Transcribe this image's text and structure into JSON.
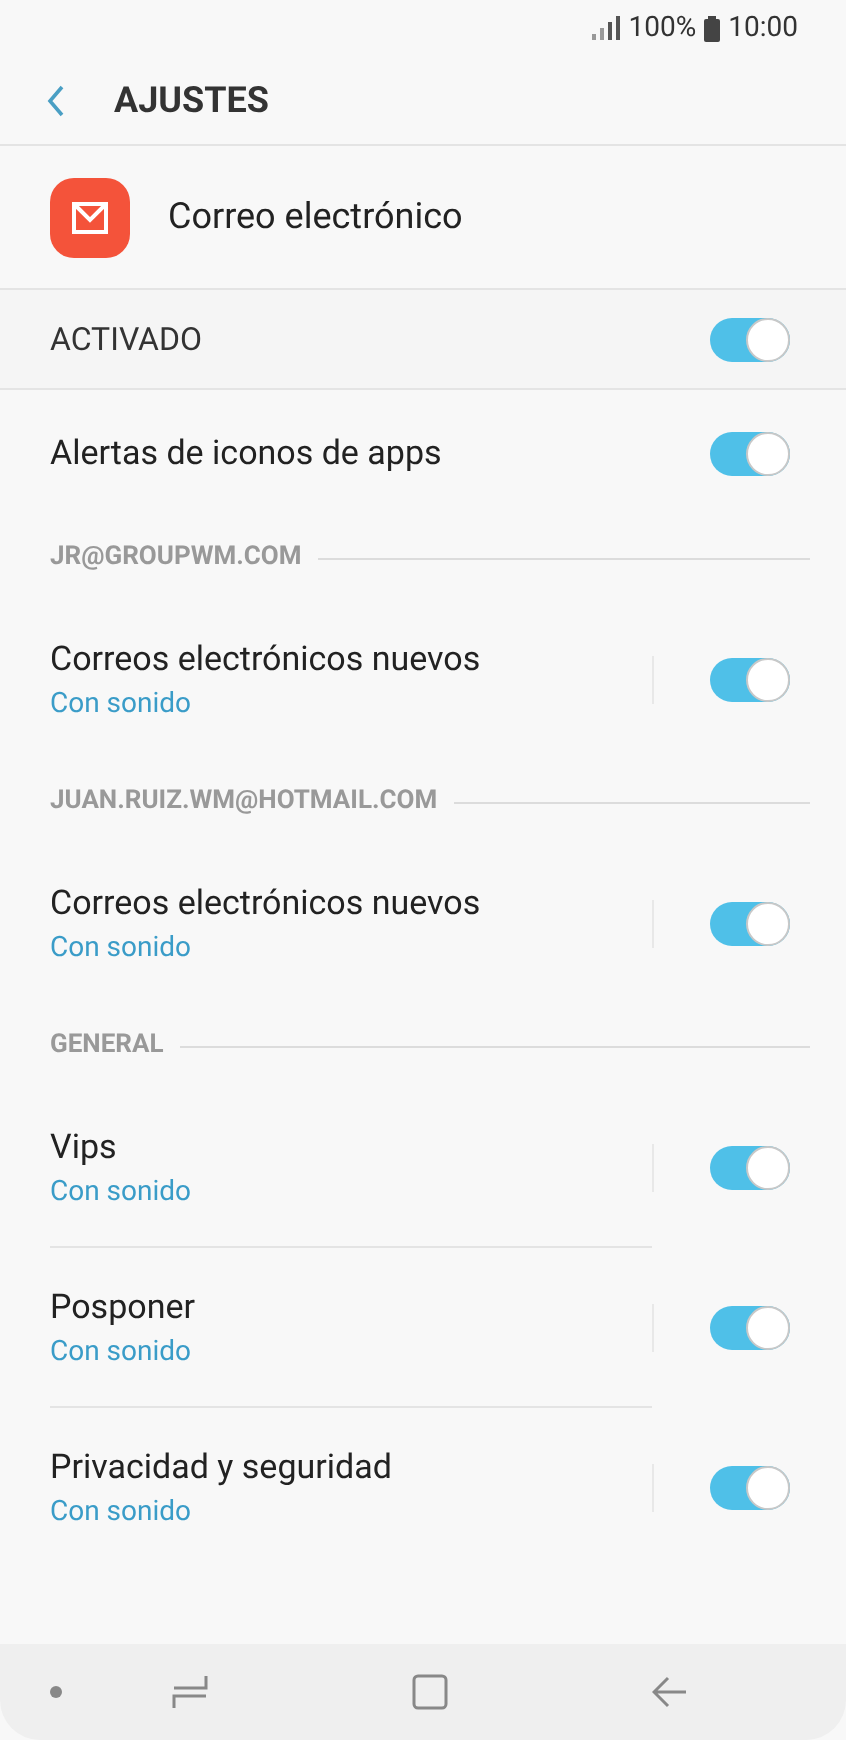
{
  "status_bar": {
    "battery": "100%",
    "time": "10:00"
  },
  "header": {
    "title": "AJUSTES"
  },
  "app": {
    "name": "Correo electrónico"
  },
  "master": {
    "label": "ACTIVADO",
    "on": true
  },
  "items": [
    {
      "kind": "row",
      "title": "Alertas de iconos de apps",
      "on": true
    },
    {
      "kind": "section",
      "title": "JR@GROUPWM.COM"
    },
    {
      "kind": "row",
      "title": "Correos electrónicos nuevos",
      "subtitle": "Con sonido",
      "on": true
    },
    {
      "kind": "section",
      "title": "JUAN.RUIZ.WM@HOTMAIL.COM"
    },
    {
      "kind": "row",
      "title": "Correos electrónicos nuevos",
      "subtitle": "Con sonido",
      "on": true
    },
    {
      "kind": "section",
      "title": "GENERAL"
    },
    {
      "kind": "row",
      "title": "Vips",
      "subtitle": "Con sonido",
      "on": true
    },
    {
      "kind": "row",
      "title": "Posponer",
      "subtitle": "Con sonido",
      "on": true
    },
    {
      "kind": "row",
      "title": "Privacidad y seguridad",
      "subtitle": "Con sonido",
      "on": true
    }
  ]
}
